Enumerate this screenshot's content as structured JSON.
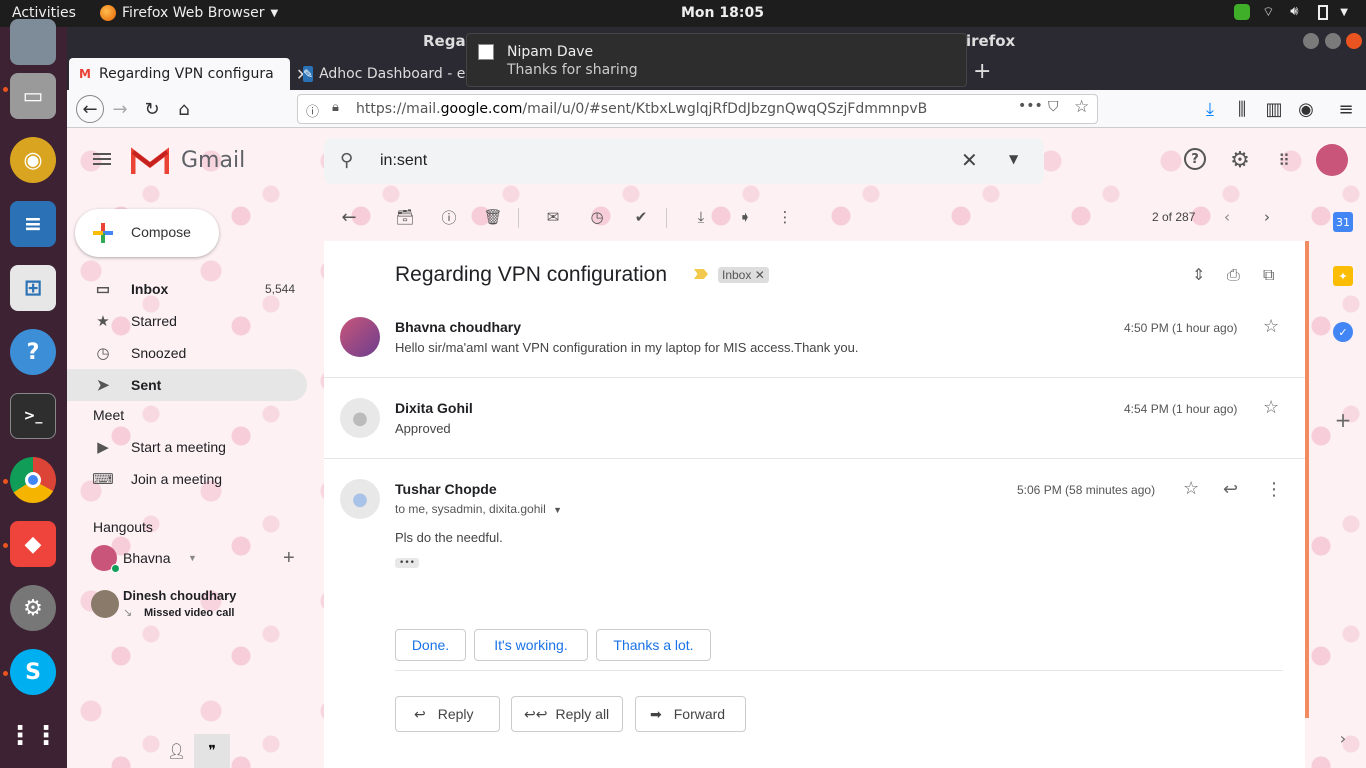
{
  "topbar": {
    "activities": "Activities",
    "app_name": "Firefox Web Browser",
    "clock": "Mon 18:05"
  },
  "window": {
    "title_left": "Regar",
    "title_right": "irefox"
  },
  "tabs": [
    {
      "label": "Regarding VPN configura",
      "active": true
    },
    {
      "label": "Adhoc Dashboard - en",
      "active": false
    }
  ],
  "url": {
    "prefix": "https://mail.",
    "host": "google.com",
    "path": "/mail/u/0/#sent/KtbxLwglqjRfDdJbzgnQwqQSzjFdmmnpvB"
  },
  "notification": {
    "title": "Nipam Dave",
    "body": "Thanks for sharing"
  },
  "gmail": {
    "logo": "Gmail",
    "search_value": "in:sent",
    "compose": "Compose",
    "nav": [
      {
        "label": "Inbox",
        "count": "5,544"
      },
      {
        "label": "Starred",
        "count": ""
      },
      {
        "label": "Snoozed",
        "count": ""
      },
      {
        "label": "Sent",
        "count": ""
      }
    ],
    "meet": {
      "heading": "Meet",
      "start": "Start a meeting",
      "join": "Join a meeting"
    },
    "hangouts": {
      "heading": "Hangouts",
      "user": "Bhavna",
      "contact_name": "Dinesh choudhary",
      "contact_status": "Missed video call"
    },
    "pagination": "2 of 287"
  },
  "thread": {
    "subject": "Regarding VPN configuration",
    "label": "Inbox",
    "messages": [
      {
        "sender": "Bhavna choudhary",
        "time": "4:50 PM (1 hour ago)",
        "snippet": "Hello sir/ma'amI want VPN configuration in my laptop for MIS access.Thank you."
      },
      {
        "sender": "Dixita Gohil",
        "time": "4:54 PM (1 hour ago)",
        "snippet": "Approved"
      },
      {
        "sender": "Tushar Chopde",
        "time": "5:06 PM (58 minutes ago)",
        "recipients": "to me, sysadmin, dixita.gohil",
        "body": "Pls do the needful."
      }
    ],
    "smart_replies": [
      "Done.",
      "It's working.",
      "Thanks a lot."
    ],
    "actions": {
      "reply": "Reply",
      "reply_all": "Reply all",
      "forward": "Forward"
    }
  },
  "colors": {
    "accent": "#1a73e8",
    "gmail_red": "#ea4335",
    "scroll_accent": "#f28b60"
  }
}
